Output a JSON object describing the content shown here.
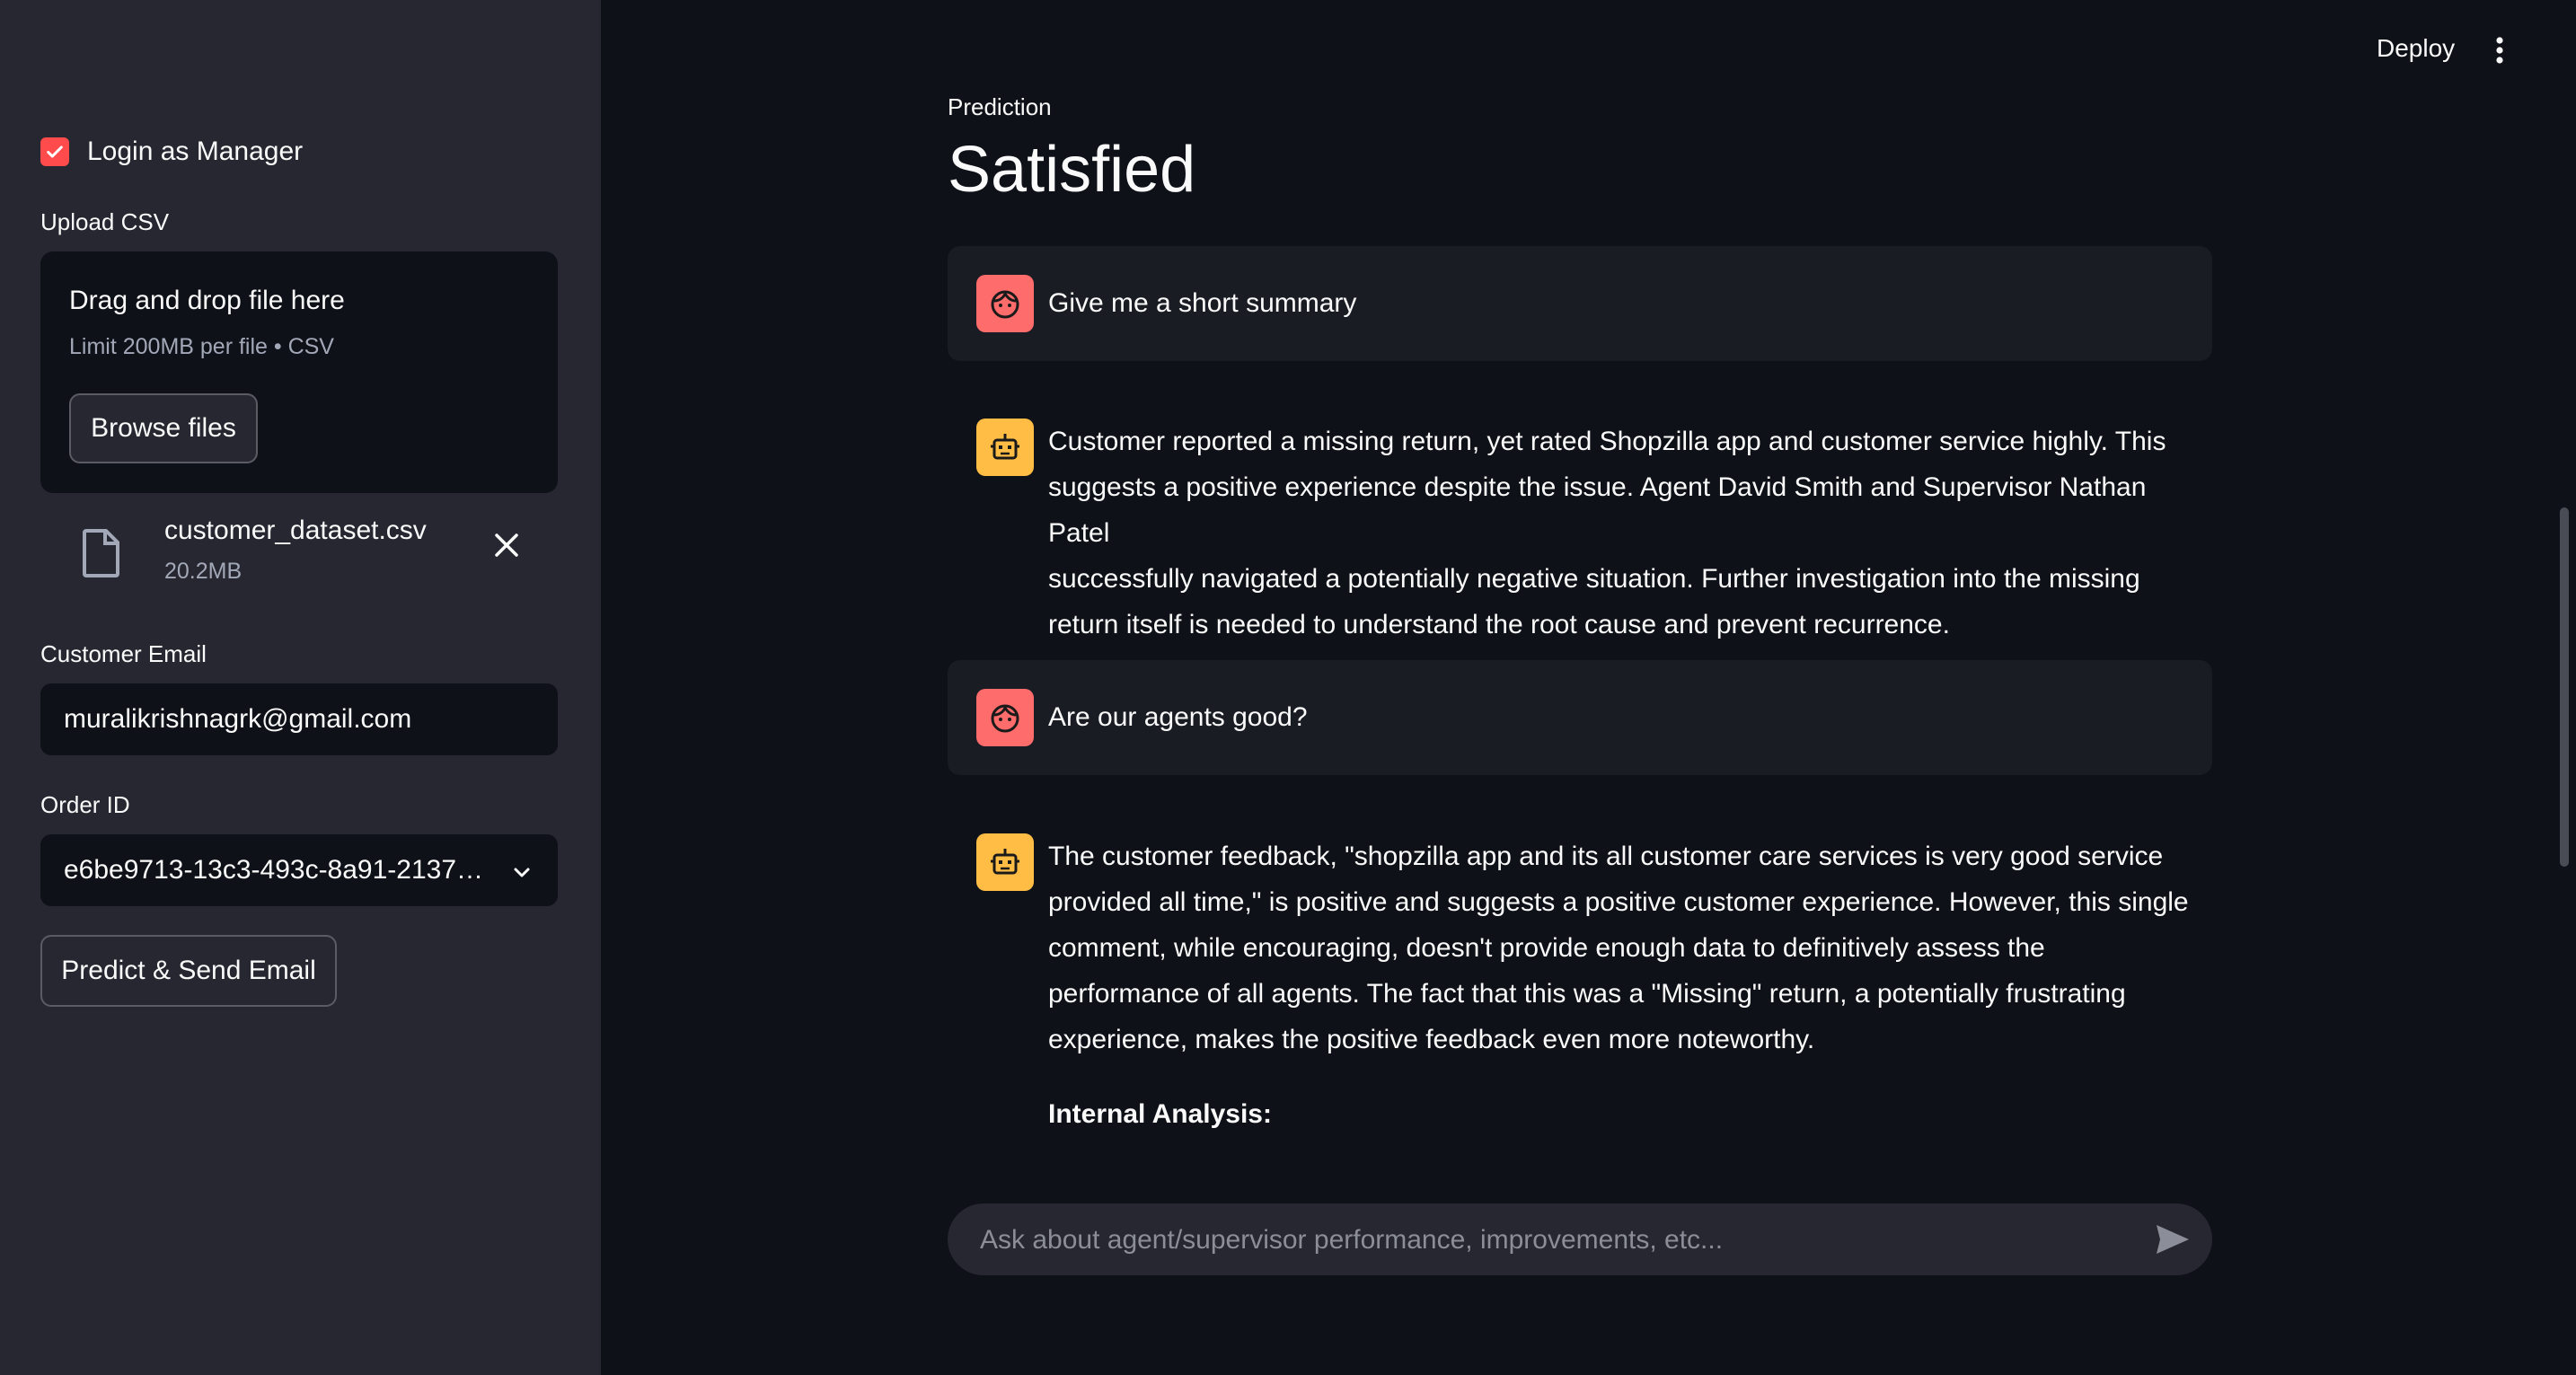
{
  "header": {
    "deploy_label": "Deploy"
  },
  "sidebar": {
    "login_checkbox": {
      "label": "Login as Manager",
      "checked": true
    },
    "upload": {
      "label": "Upload CSV",
      "dropzone_title": "Drag and drop file here",
      "dropzone_limit": "Limit 200MB per file • CSV",
      "browse_label": "Browse files",
      "file": {
        "name": "customer_dataset.csv",
        "size": "20.2MB"
      }
    },
    "email": {
      "label": "Customer Email",
      "value": "muralikrishnagrk@gmail.com"
    },
    "order": {
      "label": "Order ID",
      "value": "e6be9713-13c3-493c-8a91-2137…"
    },
    "predict_label": "Predict & Send Email"
  },
  "main": {
    "metric": {
      "label": "Prediction",
      "value": "Satisfied"
    },
    "messages": [
      {
        "role": "user",
        "text": "Give me a short summary"
      },
      {
        "role": "assistant",
        "lines": [
          "Customer reported a missing return, yet rated Shopzilla app and customer service highly. This",
          "suggests a positive experience despite the issue. Agent David Smith and Supervisor Nathan Patel",
          "successfully navigated a potentially negative situation. Further investigation into the missing",
          "return itself is needed to understand the root cause and prevent recurrence."
        ]
      },
      {
        "role": "user",
        "text": "Are our agents good?"
      },
      {
        "role": "assistant",
        "lines": [
          "The customer feedback, \"shopzilla app and its all customer care services is very good service",
          "provided all time,\" is positive and suggests a positive customer experience. However, this single",
          "comment, while encouraging, doesn't provide enough data to definitively assess the",
          "performance of all agents. The fact that this was a \"Missing\" return, a potentially frustrating",
          "experience, makes the positive feedback even more noteworthy."
        ],
        "heading": "Internal Analysis:"
      }
    ],
    "chat_input": {
      "placeholder": "Ask about agent/supervisor performance, improvements, etc..."
    }
  },
  "colors": {
    "accent": "#ff4b4b",
    "sidebar_bg": "#262730",
    "main_bg": "#0e1117",
    "user_avatar": "#ff6c6c",
    "bot_avatar": "#ffbd45"
  },
  "icons": [
    "check-icon",
    "file-icon",
    "close-icon",
    "chevron-down-icon",
    "kebab-menu-icon",
    "user-face-icon",
    "robot-icon",
    "send-icon"
  ]
}
